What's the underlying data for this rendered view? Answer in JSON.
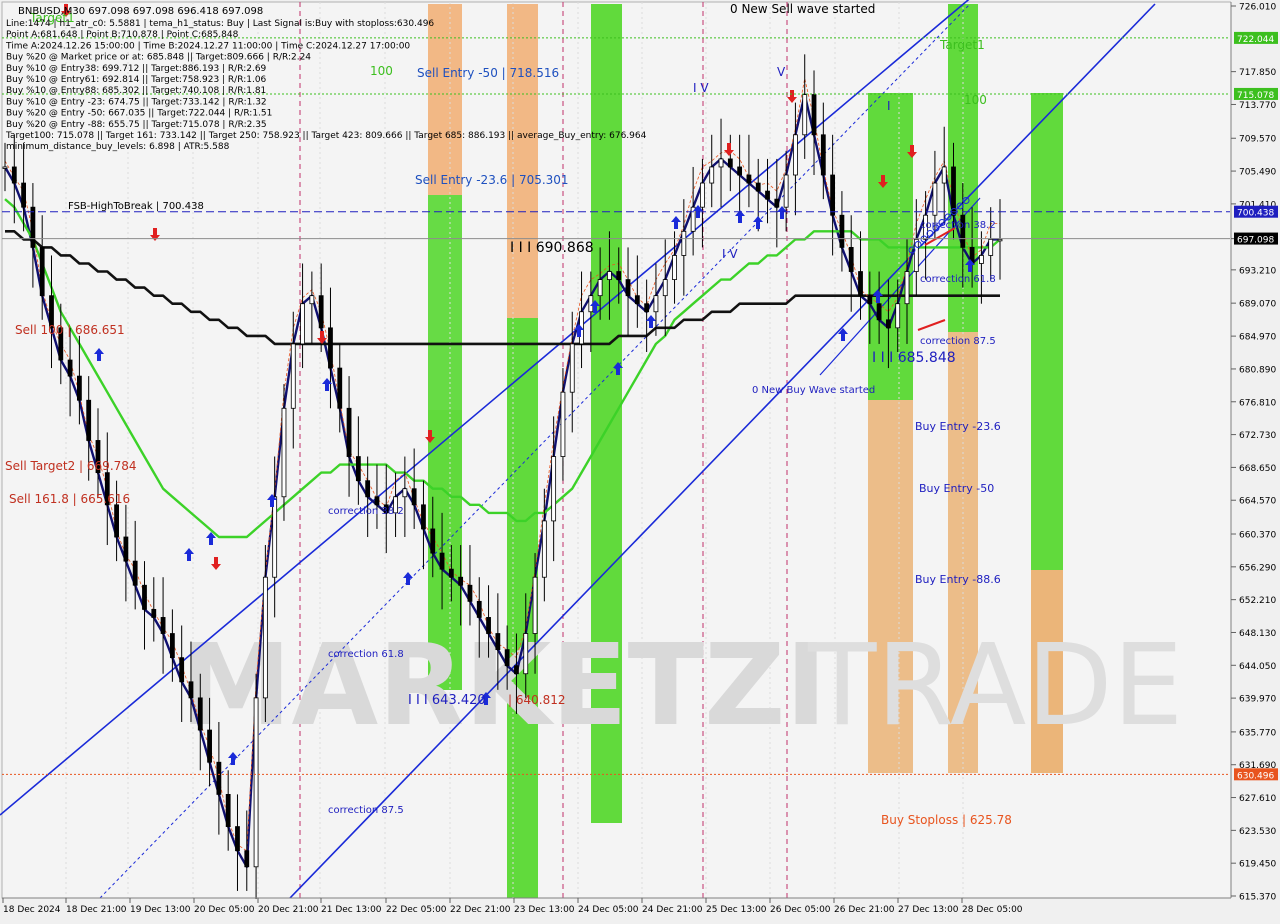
{
  "header": {
    "symbol_line": "BNBUSD,M30  697.098 697.098 696.418 697.098",
    "lines": [
      "Line:1474 | h1_atr_c0: 5.5881 | tema_h1_status: Buy | Last Signal is:Buy with stoploss:630.496",
      "Point A:681.648 | Point B:710.878 | Point C:685.848",
      "Time A:2024.12.26 15:00:00 | Time B:2024.12.27 11:00:00 | Time C:2024.12.27 17:00:00",
      "Buy %20 @ Market price or at: 685.848 || Target:809.666 | R/R:2.24",
      "Buy %10 @ Entry38: 699.712 || Target:886.193 | R/R:2.69",
      "Buy %10 @ Entry61: 692.814 || Target:758.923 | R/R:1.06",
      "Buy %10 @ Entry88: 685.302 || Target:740.108 | R/R:1.81",
      "Buy %10 @ Entry -23: 674.75 || Target:733.142 | R/R:1.32",
      "Buy %20 @ Entry -50: 667.035 || Target:722.044 | R/R:1.51",
      "Buy %20 @ Entry -88: 655.75 || Target:715.078 | R/R:2.35",
      "Target100: 715.078 || Target 161: 733.142 || Target 250: 758.923 || Target 423: 809.666 || Target 685: 886.193 || average_Buy_entry: 676.964",
      "minimum_distance_buy_levels: 6.898 | ATR:5.588"
    ]
  },
  "price_axis": {
    "ticks": [
      "726.010",
      "717.850",
      "713.770",
      "709.570",
      "705.490",
      "701.410",
      "697.090",
      "693.210",
      "689.070",
      "684.970",
      "680.890",
      "676.810",
      "672.730",
      "668.650",
      "664.570",
      "660.370",
      "656.290",
      "652.210",
      "648.130",
      "644.050",
      "639.970",
      "635.770",
      "631.690",
      "627.610",
      "623.530",
      "619.450",
      "615.370"
    ],
    "tags": [
      {
        "label": "722.044",
        "color": "#3cbf1e"
      },
      {
        "label": "715.078",
        "color": "#3cbf1e"
      },
      {
        "label": "700.438",
        "color": "#1e1ebf"
      },
      {
        "label": "697.098",
        "color": "#000000"
      },
      {
        "label": "630.496",
        "color": "#e8541e"
      }
    ]
  },
  "time_axis": {
    "labels": [
      "18 Dec 2024",
      "18 Dec 21:00",
      "19 Dec 13:00",
      "20 Dec 05:00",
      "20 Dec 21:00",
      "21 Dec 13:00",
      "22 Dec 05:00",
      "22 Dec 21:00",
      "23 Dec 13:00",
      "24 Dec 05:00",
      "24 Dec 21:00",
      "25 Dec 13:00",
      "26 Dec 05:00",
      "26 Dec 21:00",
      "27 Dec 13:00",
      "28 Dec 05:00"
    ]
  },
  "annotations": [
    {
      "text": "0 New Sell wave started",
      "color": "#000000"
    },
    {
      "text": "Sell Entry -50 | 718.516",
      "color": "#1e50bf"
    },
    {
      "text": "Sell Entry -23.6 | 705.301",
      "color": "#1e50bf"
    },
    {
      "text": "FSB-HighToBreak | 700.438",
      "color": "#000000"
    },
    {
      "text": "I I I 690.868",
      "color": "#000000"
    },
    {
      "text": "Sell 100 | 686.651",
      "color": "#c03020"
    },
    {
      "text": "Sell Target2 | 669.784",
      "color": "#c03020"
    },
    {
      "text": "Sell 161.8 | 665.616",
      "color": "#c03020"
    },
    {
      "text": "correction 38.2",
      "color": "#1e1ebf"
    },
    {
      "text": "correction 61.8",
      "color": "#1e1ebf"
    },
    {
      "text": "correction 87.5",
      "color": "#1e1ebf"
    },
    {
      "text": "correction 38.2",
      "color": "#1e1ebf"
    },
    {
      "text": "correction 61.8",
      "color": "#1e1ebf"
    },
    {
      "text": "correction 87.5",
      "color": "#1e1ebf"
    },
    {
      "text": "I I I 685.848",
      "color": "#1e1ebf"
    },
    {
      "text": "0 New Buy Wave started",
      "color": "#1e1ebf"
    },
    {
      "text": "Buy Entry -23.6",
      "color": "#1e1ebf"
    },
    {
      "text": "Buy Entry -50",
      "color": "#1e1ebf"
    },
    {
      "text": "Buy Entry -88.6",
      "color": "#1e1ebf"
    },
    {
      "text": "Buy Stoploss | 625.78",
      "color": "#e8541e"
    },
    {
      "text": "I I I 643.420",
      "color": "#1e1ebf"
    },
    {
      "text": "| 640.812",
      "color": "#c03020"
    },
    {
      "text": "Target1",
      "color": "#3cbf1e"
    },
    {
      "text": "100",
      "color": "#3cbf1e"
    },
    {
      "text": "100",
      "color": "#3cbf1e"
    },
    {
      "text": "Target1",
      "color": "#3cbf1e"
    },
    {
      "text": "I V",
      "color": "#1e1ebf"
    },
    {
      "text": "V",
      "color": "#1e1ebf"
    },
    {
      "text": "I",
      "color": "#1e1ebf"
    },
    {
      "text": "I V",
      "color": "#1e1ebf"
    }
  ],
  "watermark": {
    "text_left": "MARKETZI",
    "text_right": "TRADE"
  },
  "chart_data": {
    "type": "line",
    "title": "BNBUSD,M30",
    "ylim": [
      615.37,
      726.01
    ],
    "series": [
      {
        "name": "Close",
        "values": [
          706,
          704,
          701,
          696,
          690,
          686,
          682,
          680,
          677,
          672,
          668,
          664,
          660,
          657,
          654,
          651,
          650,
          648,
          645,
          642,
          640,
          636,
          632,
          628,
          624,
          621,
          619,
          640,
          655,
          665,
          676,
          684,
          689,
          690,
          686,
          681,
          676,
          670,
          667,
          665,
          664,
          663,
          665,
          666,
          664,
          661,
          658,
          656,
          655,
          654,
          652,
          650,
          648,
          646,
          644,
          643,
          648,
          655,
          662,
          670,
          678,
          684,
          688,
          690,
          692,
          693,
          692,
          690,
          689,
          688,
          690,
          692,
          695,
          698,
          701,
          704,
          706,
          707,
          706,
          705,
          704,
          703,
          702,
          701,
          705,
          710,
          715,
          710,
          705,
          700,
          696,
          693,
          690,
          689,
          687,
          686,
          689,
          693,
          697,
          700,
          704,
          706,
          700,
          696,
          694,
          695,
          697,
          697
        ]
      },
      {
        "name": "MA",
        "values": [
          702,
          701,
          699,
          697,
          694,
          691,
          688,
          686,
          684,
          682,
          680,
          678,
          676,
          674,
          672,
          670,
          668,
          666,
          665,
          664,
          663,
          662,
          661,
          660,
          660,
          660,
          660,
          661,
          662,
          663,
          664,
          665,
          666,
          667,
          668,
          668,
          669,
          669,
          669,
          669,
          669,
          669,
          668,
          668,
          667,
          667,
          666,
          666,
          665,
          665,
          664,
          664,
          663,
          663,
          663,
          662,
          662,
          663,
          663,
          664,
          665,
          666,
          668,
          670,
          672,
          674,
          676,
          678,
          680,
          682,
          684,
          685,
          687,
          688,
          689,
          690,
          691,
          692,
          692,
          693,
          694,
          694,
          695,
          695,
          696,
          697,
          697,
          698,
          698,
          698,
          698,
          698,
          697,
          697,
          697,
          696,
          696,
          696,
          696,
          696,
          696,
          696,
          696,
          696,
          696,
          696,
          696,
          697
        ]
      },
      {
        "name": "Slow MA",
        "values": [
          698,
          698,
          697,
          697,
          696,
          696,
          695,
          695,
          694,
          694,
          693,
          693,
          692,
          692,
          691,
          691,
          690,
          690,
          689,
          689,
          688,
          688,
          687,
          687,
          686,
          686,
          685,
          685,
          685,
          684,
          684,
          684,
          684,
          684,
          684,
          684,
          684,
          684,
          684,
          684,
          684,
          684,
          684,
          684,
          684,
          684,
          684,
          684,
          684,
          684,
          684,
          684,
          684,
          684,
          684,
          684,
          684,
          684,
          684,
          684,
          684,
          684,
          684,
          684,
          684,
          684,
          685,
          685,
          685,
          685,
          686,
          686,
          686,
          687,
          687,
          687,
          688,
          688,
          688,
          689,
          689,
          689,
          689,
          689,
          689,
          690,
          690,
          690,
          690,
          690,
          690,
          690,
          690,
          690,
          690,
          690,
          690,
          690,
          690,
          690,
          690,
          690,
          690,
          690,
          690,
          690,
          690,
          690
        ]
      }
    ]
  }
}
